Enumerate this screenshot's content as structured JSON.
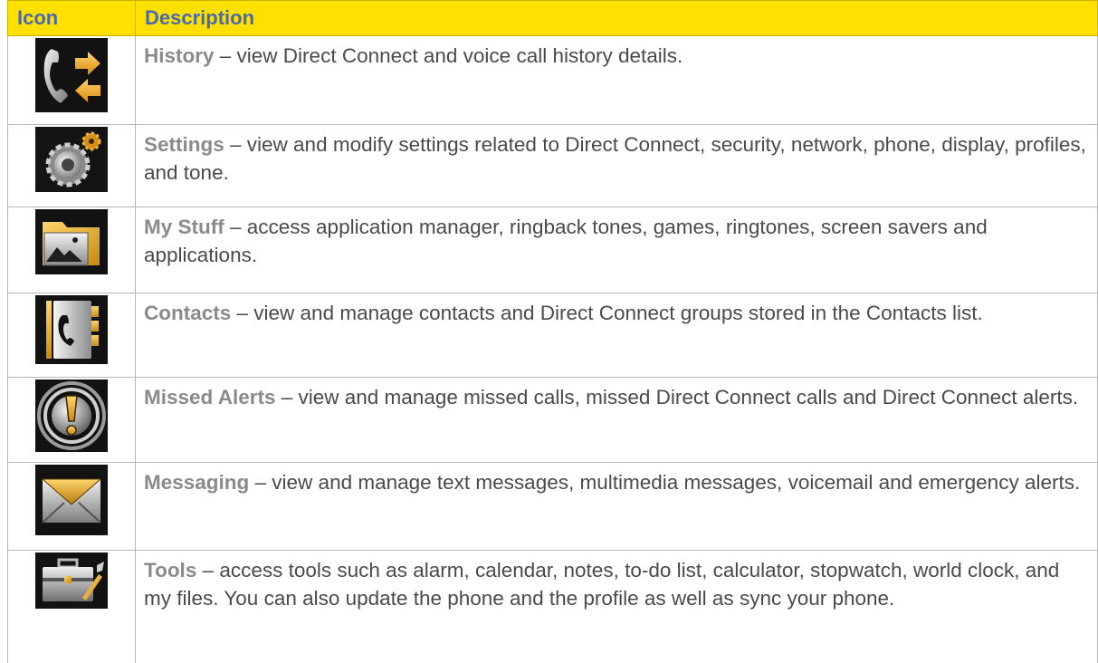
{
  "header": {
    "icon": "Icon",
    "description": "Description"
  },
  "rows": [
    {
      "icon": "phone-history-icon",
      "name": "History",
      "text": " – view Direct Connect and voice call history details."
    },
    {
      "icon": "settings-gears-icon",
      "name": "Settings",
      "text": " – view and modify settings related to Direct Connect, security, network, phone, display, profiles, and tone."
    },
    {
      "icon": "my-stuff-folder-icon",
      "name": "My Stuff",
      "text": " – access application manager, ringback tones, games, ringtones, screen savers and applications."
    },
    {
      "icon": "contacts-book-icon",
      "name": "Contacts",
      "text": " – view and manage contacts and Direct Connect groups stored in the Contacts list."
    },
    {
      "icon": "missed-alerts-icon",
      "name": "Missed Alerts",
      "text": " – view and manage missed calls, missed Direct Connect calls and Direct Connect alerts."
    },
    {
      "icon": "messaging-envelope-icon",
      "name": "Messaging",
      "text": " – view and manage text messages, multimedia messages, voicemail and emergency alerts."
    },
    {
      "icon": "tools-toolbox-icon",
      "name": "Tools",
      "text": " – access tools such as alarm, calendar, notes, to-do list, calculator, stopwatch, world clock, and my files. You can also update the phone and the profile as well as sync your phone."
    }
  ]
}
